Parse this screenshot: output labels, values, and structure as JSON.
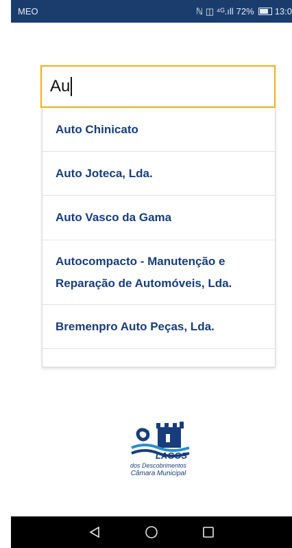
{
  "status_bar": {
    "carrier": "MEO",
    "icons_text": "ℕ ◫ ⁴ᴳ.ıll",
    "battery": "72%",
    "time": "13:0"
  },
  "search": {
    "value": "Au"
  },
  "suggestions": [
    {
      "label": "Auto Chinicato"
    },
    {
      "label": "Auto Joteca, Lda."
    },
    {
      "label": "Auto Vasco da Gama"
    },
    {
      "label": "Autocompacto - Manutenção e Reparação de Automóveis, Lda."
    },
    {
      "label": "Bremenpro Auto Peças, Lda."
    }
  ],
  "logo": {
    "name": "LAGOS",
    "line1": "dos Descobrimentos",
    "line2": "Câmara Municipal"
  },
  "nav": {
    "back_icon": "triangle-back-icon",
    "home_icon": "circle-home-icon",
    "recents_icon": "square-recents-icon"
  },
  "colors": {
    "status_bar": "#1b3d6e",
    "accent_border": "#f0ad1e",
    "item_text": "#173d7d"
  }
}
